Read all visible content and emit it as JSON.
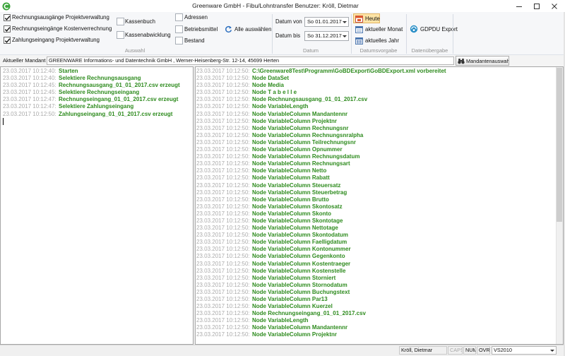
{
  "window": {
    "title": "Greenware GmbH - Fibu/Lohntransfer Benutzer: Kröll, Dietmar",
    "icon": "greenware-app-icon"
  },
  "ribbon": {
    "auswahl": {
      "label": "Auswahl",
      "items": [
        {
          "label": "Rechnungsausgänge Projektverwaltung",
          "checked": true
        },
        {
          "label": "Rechnungseingänge Kostenverrechnung",
          "checked": true
        },
        {
          "label": "Zahlungseingang Projektverwaltung",
          "checked": true
        },
        {
          "label": "Kassenbuch",
          "checked": false
        },
        {
          "label": "Kassenabwicklung",
          "checked": false
        },
        {
          "label": "Adressen",
          "checked": false
        },
        {
          "label": "Betriebsmittel",
          "checked": false
        },
        {
          "label": "Bestand",
          "checked": false
        }
      ],
      "select_all": {
        "label": "Alle auswählen",
        "icon": "refresh-icon"
      }
    },
    "datum": {
      "label": "Datum",
      "from_label": "Datum von",
      "from_value": "So 01.01.2017",
      "to_label": "Datum bis",
      "to_value": "So 31.12.2017"
    },
    "datumsvorgabe": {
      "label": "Datumsvorgabe",
      "buttons": [
        {
          "label": "Heute",
          "active": true,
          "icon": "calendar-today-icon"
        },
        {
          "label": "aktueller Monat",
          "active": false,
          "icon": "calendar-month-icon"
        },
        {
          "label": "aktuelles Jahr",
          "active": false,
          "icon": "calendar-year-icon"
        }
      ]
    },
    "datenuebergabe": {
      "label": "Datenübergabe",
      "export": {
        "label": "GDPDU Export",
        "icon": "export-icon"
      }
    }
  },
  "mandant": {
    "label": "Aktueller Mandant",
    "value": "GREENWARE Informations- und Datentechnik GmbH , Werner-Heisenberg-Str. 12-14, 45699 Herten",
    "button": {
      "label": "Mandantenauswahl",
      "icon": "binoculars-icon"
    }
  },
  "log_left": [
    {
      "time": "23.03.2017 10:12:40:",
      "message": "Starten"
    },
    {
      "time": "23.03.2017 10:12:40:",
      "message": "Selektiere Rechnungsausgang"
    },
    {
      "time": "23.03.2017 10:12:45:",
      "message": "Rechnungsausgang_01_01_2017.csv erzeugt"
    },
    {
      "time": "23.03.2017 10:12:45:",
      "message": "Selektiere Rechnungseingang"
    },
    {
      "time": "23.03.2017 10:12:47:",
      "message": "Rechnungseingang_01_01_2017.csv erzeugt"
    },
    {
      "time": "23.03.2017 10:12:47:",
      "message": "Selektiere Zahlungseingang"
    },
    {
      "time": "23.03.2017 10:12:50:",
      "message": "Zahlungseingang_01_01_2017.csv erzeugt"
    }
  ],
  "log_right": [
    {
      "time": "23.03.2017 10:12:50:",
      "message": "C:\\Greenware8Test\\Programm\\GoBDExport\\GoBDExport.xml vorbereitet"
    },
    {
      "time": "23.03.2017 10:12:50:",
      "message": "Node DataSet"
    },
    {
      "time": "23.03.2017 10:12:50:",
      "message": "Node Media"
    },
    {
      "time": "23.03.2017 10:12:50:",
      "message": "Node T a b e l l e"
    },
    {
      "time": "23.03.2017 10:12:50:",
      "message": "Node Rechnungsausgang_01_01_2017.csv"
    },
    {
      "time": "23.03.2017 10:12:50:",
      "message": "Node VariableLength"
    },
    {
      "time": "23.03.2017 10:12:50:",
      "message": "Node VariableColumn Mandantennr"
    },
    {
      "time": "23.03.2017 10:12:50:",
      "message": "Node VariableColumn Projektnr"
    },
    {
      "time": "23.03.2017 10:12:50:",
      "message": "Node VariableColumn Rechnungsnr"
    },
    {
      "time": "23.03.2017 10:12:50:",
      "message": "Node VariableColumn Rechnungsnralpha"
    },
    {
      "time": "23.03.2017 10:12:50:",
      "message": "Node VariableColumn Teilrechnungsnr"
    },
    {
      "time": "23.03.2017 10:12:50:",
      "message": "Node VariableColumn Opnummer"
    },
    {
      "time": "23.03.2017 10:12:50:",
      "message": "Node VariableColumn Rechnungsdatum"
    },
    {
      "time": "23.03.2017 10:12:50:",
      "message": "Node VariableColumn Rechnungsart"
    },
    {
      "time": "23.03.2017 10:12:50:",
      "message": "Node VariableColumn Netto"
    },
    {
      "time": "23.03.2017 10:12:50:",
      "message": "Node VariableColumn Rabatt"
    },
    {
      "time": "23.03.2017 10:12:50:",
      "message": "Node VariableColumn Steuersatz"
    },
    {
      "time": "23.03.2017 10:12:50:",
      "message": "Node VariableColumn Steuerbetrag"
    },
    {
      "time": "23.03.2017 10:12:50:",
      "message": "Node VariableColumn Brutto"
    },
    {
      "time": "23.03.2017 10:12:50:",
      "message": "Node VariableColumn Skontosatz"
    },
    {
      "time": "23.03.2017 10:12:50:",
      "message": "Node VariableColumn Skonto"
    },
    {
      "time": "23.03.2017 10:12:50:",
      "message": "Node VariableColumn Skontotage"
    },
    {
      "time": "23.03.2017 10:12:50:",
      "message": "Node VariableColumn Nettotage"
    },
    {
      "time": "23.03.2017 10:12:50:",
      "message": "Node VariableColumn Skontodatum"
    },
    {
      "time": "23.03.2017 10:12:50:",
      "message": "Node VariableColumn Faelligdatum"
    },
    {
      "time": "23.03.2017 10:12:50:",
      "message": "Node VariableColumn Kontonummer"
    },
    {
      "time": "23.03.2017 10:12:50:",
      "message": "Node VariableColumn Gegenkonto"
    },
    {
      "time": "23.03.2017 10:12:50:",
      "message": "Node VariableColumn Kostentraeger"
    },
    {
      "time": "23.03.2017 10:12:50:",
      "message": "Node VariableColumn Kostenstelle"
    },
    {
      "time": "23.03.2017 10:12:50:",
      "message": "Node VariableColumn Storniert"
    },
    {
      "time": "23.03.2017 10:12:50:",
      "message": "Node VariableColumn Stornodatum"
    },
    {
      "time": "23.03.2017 10:12:50:",
      "message": "Node VariableColumn Buchungstext"
    },
    {
      "time": "23.03.2017 10:12:50:",
      "message": "Node VariableColumn Par13"
    },
    {
      "time": "23.03.2017 10:12:50:",
      "message": "Node VariableColumn Kuerzel"
    },
    {
      "time": "23.03.2017 10:12:50:",
      "message": "Node Rechnungseingang_01_01_2017.csv"
    },
    {
      "time": "23.03.2017 10:12:50:",
      "message": "Node VariableLength"
    },
    {
      "time": "23.03.2017 10:12:50:",
      "message": "Node VariableColumn Mandantennr"
    },
    {
      "time": "23.03.2017 10:12:50:",
      "message": "Node VariableColumn Projektnr"
    }
  ],
  "status": {
    "user": "Kröll, Dietmar",
    "caps": "CAPS",
    "caps_on": false,
    "num": "NUM",
    "num_on": true,
    "ovr": "OVR",
    "ovr_on": true,
    "theme": "VS2010"
  },
  "colors": {
    "log_message": "#2e8b1e",
    "log_timestamp": "#ababab",
    "active_button": "#fde4a6"
  }
}
